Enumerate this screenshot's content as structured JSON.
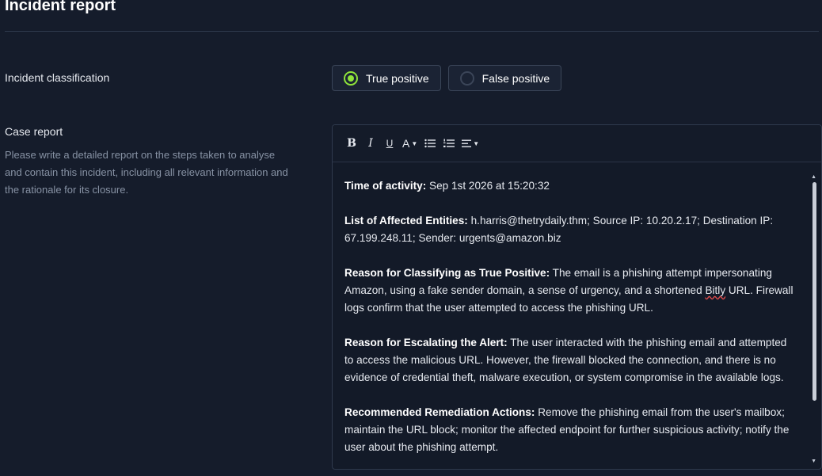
{
  "page": {
    "title": "Incident report"
  },
  "classification": {
    "label": "Incident classification",
    "options": [
      {
        "label": "True positive",
        "checked": true
      },
      {
        "label": "False positive",
        "checked": false
      }
    ],
    "accent_color": "#8fe43a"
  },
  "case_report": {
    "label": "Case report",
    "help": "Please write a detailed report on the steps taken to analyse and contain this incident, including all relevant information and the rationale for its closure.",
    "toolbar": {
      "bold": "B",
      "italic": "I",
      "underline": "U",
      "font_color": "A",
      "bullet_list_icon": "bullet-list-icon",
      "numbered_list_icon": "numbered-list-icon",
      "align_icon": "align-left-icon"
    },
    "paragraphs": [
      {
        "heading": "Time of activity:",
        "body": " Sep 1st 2026 at 15:20:32"
      },
      {
        "heading": "List of Affected Entities:",
        "body": " h.harris@thetrydaily.thm; Source IP: 10.20.2.17; Destination IP: 67.199.248.11; Sender: urgents@amazon.biz"
      },
      {
        "heading": "Reason for Classifying as True Positive:",
        "body_pre": " The email is a phishing attempt impersonating Amazon, using a fake sender domain, a sense of urgency, and a shortened ",
        "body_flag": "Bitly",
        "body_post": " URL. Firewall logs confirm that the user attempted to access the phishing URL."
      },
      {
        "heading": "Reason for Escalating the Alert:",
        "body": " The user interacted with the phishing email and attempted to access the malicious URL. However, the firewall blocked the connection, and there is no evidence of credential theft, malware execution, or system compromise in the available logs."
      },
      {
        "heading": "Recommended Remediation Actions:",
        "body": " Remove the phishing email from the user's mailbox; maintain the URL block; monitor the affected endpoint for further suspicious activity; notify the user about the phishing attempt."
      }
    ]
  }
}
